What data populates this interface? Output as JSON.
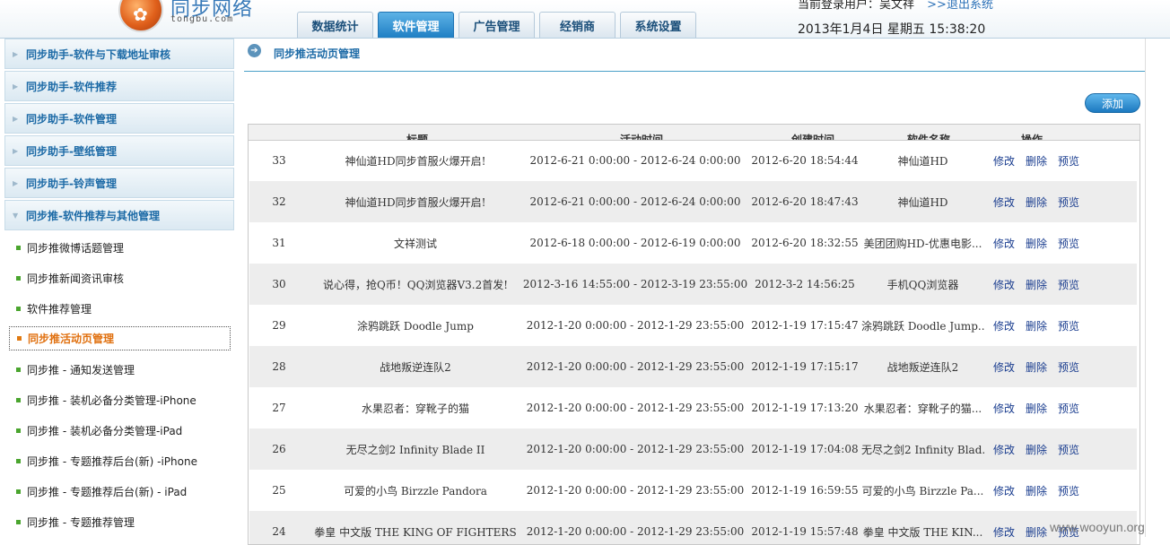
{
  "header": {
    "logo_title": "同步网络",
    "logo_sub": "tongbu.com",
    "nav": [
      {
        "label": "数据统计",
        "active": false
      },
      {
        "label": "软件管理",
        "active": true
      },
      {
        "label": "广告管理",
        "active": false
      },
      {
        "label": "经销商",
        "active": false
      },
      {
        "label": "系统设置",
        "active": false
      }
    ],
    "user_text": "当前登录用户：吴文祥",
    "logout": ">>退出系统",
    "datetime": "2013年1月4日  星期五  15:38:20"
  },
  "sidebar": {
    "groups": [
      {
        "label": "同步助手-软件与下载地址审核"
      },
      {
        "label": "同步助手-软件推荐"
      },
      {
        "label": "同步助手-软件管理"
      },
      {
        "label": "同步助手-壁纸管理"
      },
      {
        "label": "同步助手-铃声管理"
      },
      {
        "label": "同步推-软件推荐与其他管理"
      }
    ],
    "items": [
      {
        "label": "同步推微博话题管理",
        "active": false
      },
      {
        "label": "同步推新闻资讯审核",
        "active": false
      },
      {
        "label": "软件推荐管理",
        "active": false
      },
      {
        "label": "同步推活动页管理",
        "active": true
      },
      {
        "label": "同步推 - 通知发送管理",
        "active": false
      },
      {
        "label": "同步推 - 装机必备分类管理-iPhone",
        "active": false
      },
      {
        "label": "同步推 - 装机必备分类管理-iPad",
        "active": false
      },
      {
        "label": "同步推 - 专题推荐后台(新) -iPhone",
        "active": false
      },
      {
        "label": "同步推 - 专题推荐后台(新) - iPad",
        "active": false
      },
      {
        "label": "同步推 - 专题推荐管理",
        "active": false
      }
    ]
  },
  "main": {
    "title": "同步推活动页管理",
    "add_label": "添加",
    "columns": [
      "标题",
      "活动时间",
      "创建时间",
      "软件名称",
      "操作"
    ],
    "ops": [
      "修改",
      "删除",
      "预览"
    ],
    "rows": [
      {
        "id": "33",
        "title": "神仙道HD同步首服火爆开启!",
        "time": "2012-6-21 0:00:00 - 2012-6-24 0:00:00",
        "created": "2012-6-20 18:54:44",
        "soft": "神仙道HD"
      },
      {
        "id": "32",
        "title": "神仙道HD同步首服火爆开启!",
        "time": "2012-6-21 0:00:00 - 2012-6-24 0:00:00",
        "created": "2012-6-20 18:47:43",
        "soft": "神仙道HD"
      },
      {
        "id": "31",
        "title": "文祥测试",
        "time": "2012-6-18 0:00:00 - 2012-6-19 0:00:00",
        "created": "2012-6-20 18:32:55",
        "soft": "美团团购HD-优惠电影..."
      },
      {
        "id": "30",
        "title": "说心得，抢Q币！QQ浏览器V3.2首发!",
        "time": "2012-3-16 14:55:00 - 2012-3-19 23:55:00",
        "created": "2012-3-2 14:56:25",
        "soft": "手机QQ浏览器"
      },
      {
        "id": "29",
        "title": "涂鸦跳跃  Doodle Jump",
        "time": "2012-1-20 0:00:00 - 2012-1-29 23:55:00",
        "created": "2012-1-19 17:15:47",
        "soft": "涂鸦跳跃  Doodle Jump..."
      },
      {
        "id": "28",
        "title": "战地叛逆连队2",
        "time": "2012-1-20 0:00:00 - 2012-1-29 23:55:00",
        "created": "2012-1-19 17:15:17",
        "soft": "战地叛逆连队2"
      },
      {
        "id": "27",
        "title": "水果忍者：穿靴子的猫",
        "time": "2012-1-20 0:00:00 - 2012-1-29 23:55:00",
        "created": "2012-1-19 17:13:20",
        "soft": "水果忍者：穿靴子的猫..."
      },
      {
        "id": "26",
        "title": "无尽之剑2 Infinity Blade II",
        "time": "2012-1-20 0:00:00 - 2012-1-29 23:55:00",
        "created": "2012-1-19 17:04:08",
        "soft": "无尽之剑2 Infinity Blad..."
      },
      {
        "id": "25",
        "title": "可爱的小鸟  Birzzle Pandora",
        "time": "2012-1-20 0:00:00 - 2012-1-29 23:55:00",
        "created": "2012-1-19 16:59:55",
        "soft": "可爱的小鸟  Birzzle Pa..."
      },
      {
        "id": "24",
        "title": "拳皇  中文版  THE KING OF FIGHTERS",
        "time": "2012-1-20 0:00:00 - 2012-1-29 23:55:00",
        "created": "2012-1-19 15:57:48",
        "soft": "拳皇  中文版  THE KIN..."
      }
    ]
  },
  "watermark": "www.wooyun.org"
}
